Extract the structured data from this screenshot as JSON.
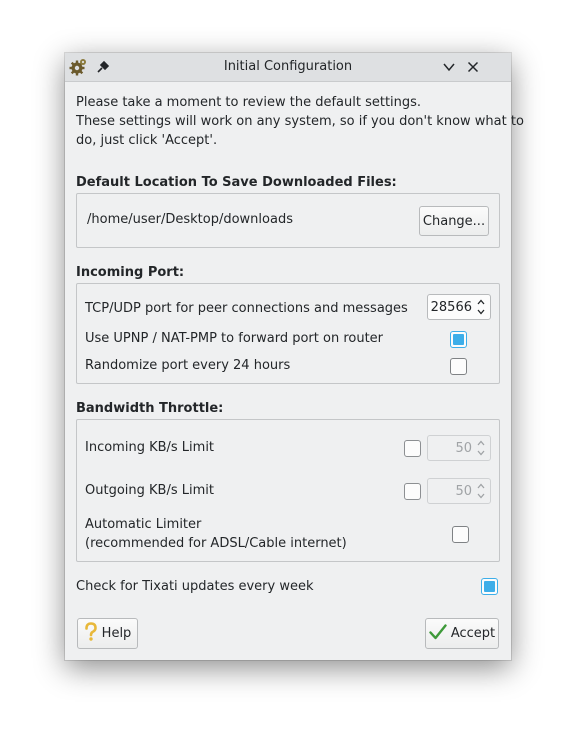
{
  "window": {
    "title": "Initial Configuration"
  },
  "intro": {
    "line1": "Please take a moment to review the default settings.",
    "line2": "These settings will work on any system, so if you don't know what to",
    "line3": "do, just click 'Accept'."
  },
  "download": {
    "heading": "Default Location To Save Downloaded Files:",
    "path": "/home/user/Desktop/downloads",
    "change_label": "Change..."
  },
  "incoming": {
    "heading": "Incoming Port:",
    "port_label": "TCP/UDP port for peer connections and messages",
    "port_value": "28566",
    "upnp_label": "Use UPNP / NAT-PMP to forward port on router",
    "upnp_checked": true,
    "randomize_label": "Randomize port every 24 hours",
    "randomize_checked": false
  },
  "bandwidth": {
    "heading": "Bandwidth Throttle:",
    "incoming_label": "Incoming KB/s Limit",
    "incoming_enabled": false,
    "incoming_value": "50",
    "outgoing_label": "Outgoing KB/s Limit",
    "outgoing_enabled": false,
    "outgoing_value": "50",
    "auto_label_line1": "Automatic Limiter",
    "auto_label_line2": "(recommended for ADSL/Cable internet)",
    "auto_checked": false
  },
  "updates": {
    "label": "Check for Tixati updates every week",
    "checked": true
  },
  "buttons": {
    "help_label": "Help",
    "accept_label": "Accept"
  },
  "colors": {
    "accent": "#3daee9",
    "help_icon": "#e8b83a",
    "accept_icon": "#3e9a3a"
  }
}
